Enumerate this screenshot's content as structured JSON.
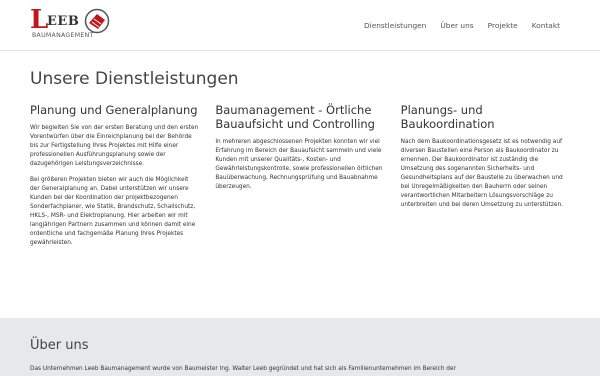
{
  "brand": {
    "initial": "L",
    "rest": "EEB",
    "subtitle": "BAUMANAGEMENT",
    "accent": "#c0171d",
    "emblem_icon": "roof-emblem-icon"
  },
  "nav": {
    "items": [
      "Dienstleistungen",
      "Über uns",
      "Projekte",
      "Kontakt"
    ]
  },
  "services": {
    "title": "Unsere Dienstleistungen",
    "columns": [
      {
        "heading": "Planung und Generalplanung",
        "paragraphs": [
          "Wir begleiten Sie von der ersten Beratung und den ersten Vorentwürfen über die Einreichplanung bei der Behörde bis zur Fertigstellung Ihres Projektes mit Hilfe einer professionellen Ausführungsplanung sowie der dazugehörigen Leistungsverzeichnisse.",
          "Bei größeren Projekten bieten wir auch die Möglichkeit der Generalplanung an. Dabei unterstützen wir unsere Kunden bei der Koordination der projektbezogenen Sonderfachplaner, wie Statik, Brandschutz, Schallschutz, HKLS-, MSR- und Elektroplanung. Hier arbeiten wir mit langjährigen Partnern zusammen und können damit eine ordentliche und fachgemäße Planung Ihres Projektes gewährleisten."
        ]
      },
      {
        "heading": "Baumanagement - Örtliche Bauaufsicht und Controlling",
        "paragraphs": [
          "In mehreren abgeschlossenen Projekten konnten wir viel Erfahrung im Bereich der Bauaufsicht sammeln und viele Kunden mit unserer Qualitäts-, Kosten- und Gewährleistungskontrolle, sowie professionellen örtlichen Bauüberwachung, Rechnungsprüfung und Bauabnahme überzeugen."
        ]
      },
      {
        "heading": "Planungs- und Baukoordination",
        "paragraphs": [
          "Nach dem Baukoordinationsgesetz ist es notwendig auf diversen Baustellen eine Person als Baukoordinator zu ernennen. Der Baukoordinator ist zuständig die Umsetzung des sogenannten Sicherheits- und Gesundheitsplans auf der Baustelle zu überwachen und bei Unregelmäßigkeiten den Bauherrn oder seinen verantwortlichen Mitarbeitern Lösungsvorschläge zu unterbreiten und bei deren Umsetzung zu unterstützen."
        ]
      }
    ]
  },
  "about": {
    "title": "Über uns",
    "text": "Das Unternehmen Leeb Baumanagement wurde von Baumeister Ing. Walter Leeb gegründet und hat sich als Familienunternehmen im Bereich der"
  }
}
